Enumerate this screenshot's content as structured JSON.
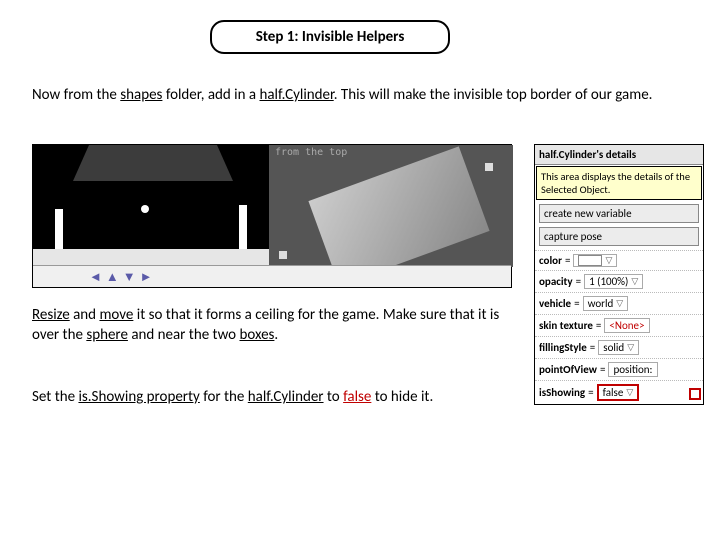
{
  "header": {
    "title": "Step 1: Invisible Helpers"
  },
  "para1": {
    "t1": "Now from the ",
    "shapes": "shapes",
    "t2": " folder, add in a ",
    "half_cyl": "half.Cylinder",
    "t3": ". This will make the invisible top border of our game."
  },
  "viewport": {
    "top_label": "from the top"
  },
  "para2": {
    "resize": "Resize",
    "t1": " and ",
    "move": "move",
    "t2": " it so that it forms a ceiling for the game. Make sure that it is over the ",
    "sphere": "sphere",
    "t3": " and near the two ",
    "boxes": "boxes",
    "t4": "."
  },
  "para3": {
    "t1": "Set the ",
    "isshowing": "is.Showing property",
    "t2": " for the ",
    "half_cyl": "half.Cylinder",
    "t3": " to ",
    "false": "false",
    "t4": " to hide it."
  },
  "panel": {
    "title": "half.Cylinder's details",
    "tooltip": "This area displays the details of the Selected Object.",
    "create_var": "create new variable",
    "capture_pose": "capture pose",
    "eq": "=",
    "rows": {
      "color": {
        "k": "color"
      },
      "opacity": {
        "k": "opacity",
        "v": "1 (100%)"
      },
      "vehicle": {
        "k": "vehicle",
        "v": "world"
      },
      "skin": {
        "k": "skin texture",
        "v": "<None>"
      },
      "filling": {
        "k": "fillingStyle",
        "v": "solid"
      },
      "pov": {
        "k": "pointOfView",
        "v": "position:"
      },
      "isshowing": {
        "k": "isShowing",
        "v": "false"
      }
    }
  }
}
